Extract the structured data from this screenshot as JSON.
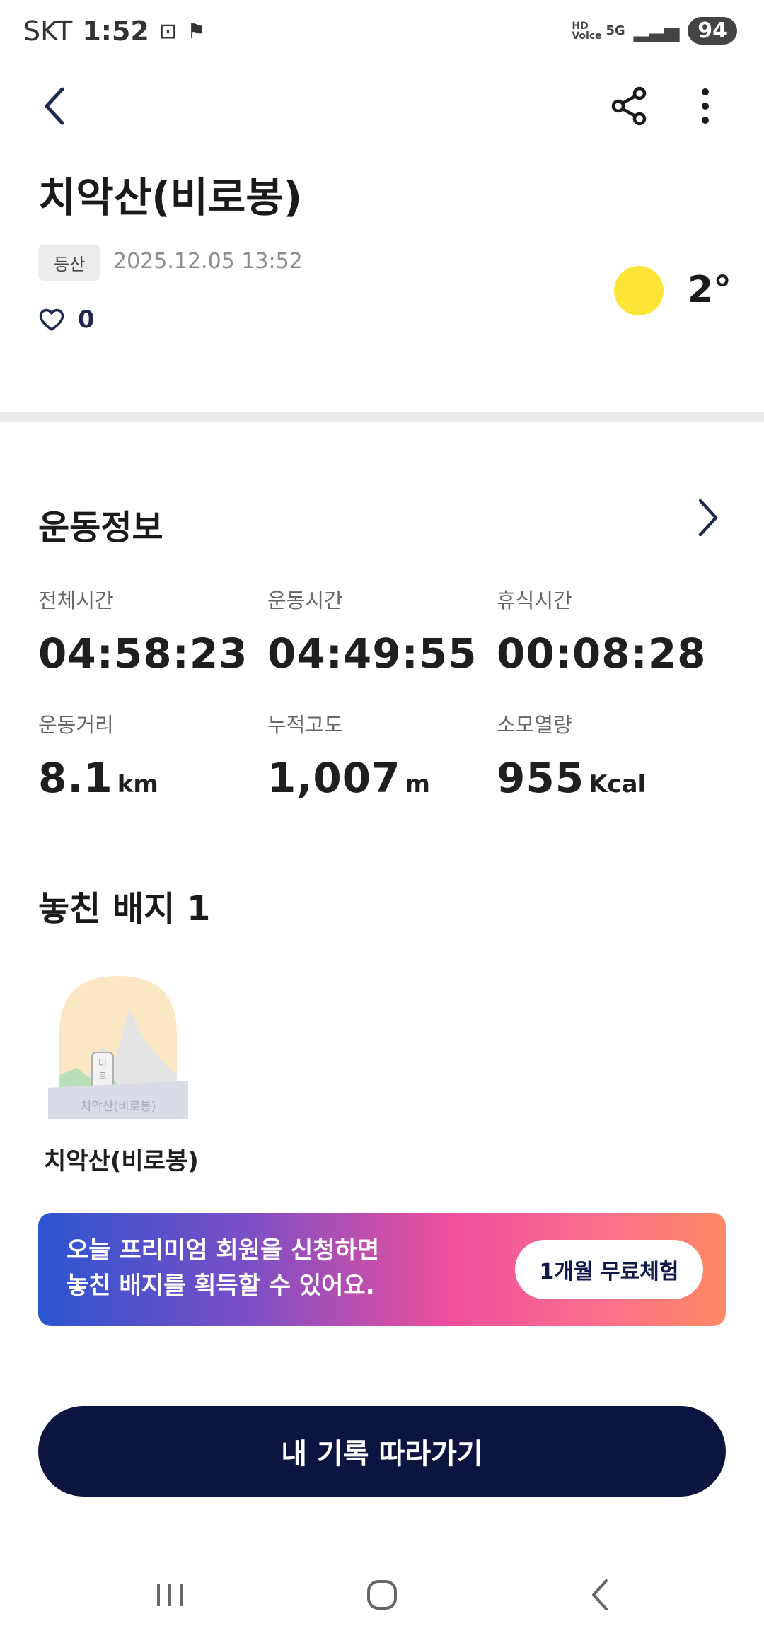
{
  "status_bar": {
    "carrier": "SKT",
    "time": "1:52",
    "hd_voice": "HD Voice",
    "network": "5G",
    "battery": "94"
  },
  "header": {
    "back_icon": "chevron-left-icon",
    "share_icon": "share-icon",
    "more_icon": "more-vertical-icon"
  },
  "activity": {
    "title": "치악산(비로봉)",
    "tag": "등산",
    "datetime": "2025.12.05 13:52",
    "likes": "0",
    "weather": {
      "icon": "sun-icon",
      "temperature": "2°"
    }
  },
  "exercise_info": {
    "title": "운동정보",
    "stats": [
      {
        "label": "전체시간",
        "value": "04:58:23",
        "unit": ""
      },
      {
        "label": "운동시간",
        "value": "04:49:55",
        "unit": ""
      },
      {
        "label": "휴식시간",
        "value": "00:08:28",
        "unit": ""
      },
      {
        "label": "운동거리",
        "value": "8.1",
        "unit": "km"
      },
      {
        "label": "누적고도",
        "value": "1,007",
        "unit": "m"
      },
      {
        "label": "소모열량",
        "value": "955",
        "unit": "Kcal"
      }
    ]
  },
  "badges": {
    "title": "놓친 배지 1",
    "items": [
      {
        "name": "치악산(비로봉)",
        "stamp_text": "치악산(비로봉)",
        "sign_text": "비로봉"
      }
    ]
  },
  "promo": {
    "line1": "오늘 프리미엄 회원을 신청하면",
    "line2": "놓친 배지를 획득할 수 있어요.",
    "button": "1개월 무료체험"
  },
  "follow_button": "내 기록 따라가기",
  "colors": {
    "navy": "#0c1440",
    "sun": "#fde537"
  }
}
